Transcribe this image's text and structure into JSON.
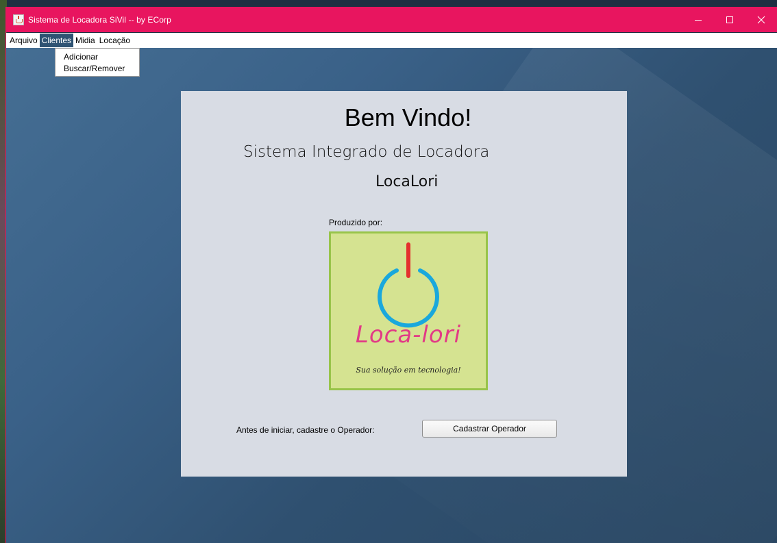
{
  "window": {
    "title": "Sistema de Locadora SiVil -- by ECorp"
  },
  "menubar": {
    "items": [
      "Arquivo",
      "Clientes",
      "Midia",
      "Locação"
    ],
    "active": "Clientes"
  },
  "dropdown": {
    "items": [
      "Adicionar",
      "Buscar/Remover"
    ]
  },
  "panel": {
    "welcome": "Bem Vindo!",
    "system_name": "Sistema Integrado de Locadora",
    "product": "LocaLori",
    "produced_by": "Produzido por:",
    "logo": {
      "name": "Loca-lori",
      "tagline": "Sua solução em tecnologia!"
    },
    "pre_label": "Antes de iniciar, cadastre o Operador:",
    "button_label": "Cadastrar Operador"
  },
  "colors": {
    "titlebar": "#e8155f",
    "menu_active": "#2f5373",
    "panel_bg": "#d8dce4",
    "logo_bg": "#d5e391",
    "logo_border": "#98c44a",
    "logo_text": "#e23a86",
    "power_ring": "#1aa8dc",
    "power_bar": "#e4302e"
  },
  "icons": {
    "app": "java-cup-icon",
    "minimize": "minimize-icon",
    "maximize": "maximize-icon",
    "close": "close-icon",
    "logo": "power-icon"
  }
}
